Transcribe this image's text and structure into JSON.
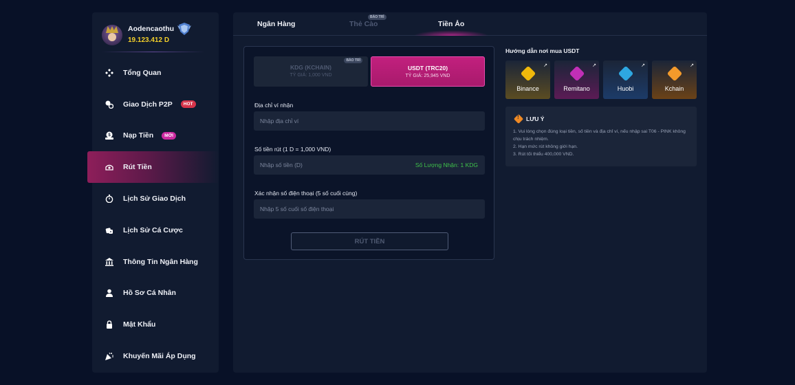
{
  "profile": {
    "username": "Aodencaothu",
    "balance": "19.123.412 D"
  },
  "sidebar": {
    "items": [
      {
        "label": "Tổng Quan",
        "icon": "diamond-grid-icon"
      },
      {
        "label": "Giao Dịch P2P",
        "icon": "p2p-coins-icon",
        "badge": "HOT"
      },
      {
        "label": "Nạp Tiền",
        "icon": "deposit-icon",
        "badge": "MỚI"
      },
      {
        "label": "Rút Tiền",
        "icon": "withdraw-icon",
        "active": true
      },
      {
        "label": "Lịch Sử Giao Dịch",
        "icon": "stopwatch-icon"
      },
      {
        "label": "Lịch Sử Cá Cược",
        "icon": "dice-icon"
      },
      {
        "label": "Thông Tin Ngân Hàng",
        "icon": "bank-icon"
      },
      {
        "label": "Hồ Sơ Cá Nhân",
        "icon": "user-icon"
      },
      {
        "label": "Mật Khẩu",
        "icon": "lock-icon"
      },
      {
        "label": "Khuyến Mãi Áp Dụng",
        "icon": "party-popper-icon"
      }
    ]
  },
  "tabs": {
    "bank": "Ngân Hàng",
    "card": "Thẻ Cào",
    "card_badge": "BẢO TRÌ",
    "crypto": "Tiền Ảo"
  },
  "coins": {
    "kdg": {
      "name": "KDG (KCHAIN)",
      "rate": "TỶ GIÁ: 1,000 VND",
      "badge": "BẢO TRÌ"
    },
    "usdt": {
      "name": "USDT (TRC20)",
      "rate": "TỶ GIÁ: 25,945 VND"
    }
  },
  "form": {
    "address_label": "Địa chỉ ví nhận",
    "address_placeholder": "Nhập địa chỉ ví",
    "amount_label": "Số tiền rút (1 D = 1,000 VND)",
    "amount_placeholder": "Nhập số tiền (D)",
    "amount_receive": "Số Lượng Nhận: 1 KDG",
    "phone_label": "Xác nhận số điện thoại (5 số cuối cùng)",
    "phone_placeholder": "Nhập 5 số cuối số điện thoại",
    "submit": "RÚT TIỀN"
  },
  "guide": {
    "title": "Hướng dẫn nơi mua USDT",
    "exchanges": [
      {
        "name": "Binance",
        "icon": "binance-icon",
        "color": "#f0b90b"
      },
      {
        "name": "Remitano",
        "icon": "remitano-icon",
        "color": "#c12fb6"
      },
      {
        "name": "Huobi",
        "icon": "huobi-icon",
        "color": "#2ea7e0"
      },
      {
        "name": "Kchain",
        "icon": "kchain-icon",
        "color": "#f39a2b"
      }
    ]
  },
  "notice": {
    "title": "LƯU Ý",
    "items": [
      "1. Vui lòng chọn đúng loại tiền, số tiền và địa chỉ ví, nếu nhập sai T06 - PINK không chịu trách nhiệm.",
      "2. Hạn mức rút không giới hạn.",
      "3. Rút tối thiểu 400,000 VND."
    ]
  },
  "colors": {
    "background": "#081127",
    "panel": "#111b30",
    "accent_pink": "#c2207e",
    "balance_gold": "#f3cf2a",
    "receive_green": "#3fc34a"
  }
}
